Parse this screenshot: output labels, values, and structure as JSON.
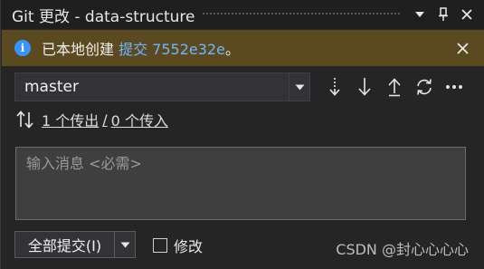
{
  "window": {
    "title": "Git 更改 - data-structure"
  },
  "info_bar": {
    "message_prefix": "已本地创建 ",
    "commit_link": "提交 7552e32e",
    "message_suffix": "。"
  },
  "branch": {
    "selected": "master"
  },
  "sync": {
    "outgoing": "1 个传出",
    "separator": "/",
    "incoming": "0 个传入"
  },
  "message": {
    "placeholder": "输入消息 <必需>",
    "value": ""
  },
  "commit": {
    "button_label": "全部提交(I)",
    "amend_label": "修改",
    "amend_checked": false
  },
  "watermark": "CSDN @封心心心心",
  "icons": {
    "title_dropdown": "chevron-down-icon",
    "title_pin": "pin-icon",
    "title_close": "close-icon",
    "info": "info-icon",
    "info_close": "close-icon",
    "fetch": "fetch-icon",
    "pull": "pull-icon",
    "push": "push-icon",
    "sync": "sync-icon",
    "more": "more-icon",
    "outgoing_incoming": "outgoing-incoming-icon"
  },
  "colors": {
    "background": "#252526",
    "info_bar": "#5b4a1f",
    "info_icon": "#3794ff",
    "link": "#6cb6ff"
  }
}
